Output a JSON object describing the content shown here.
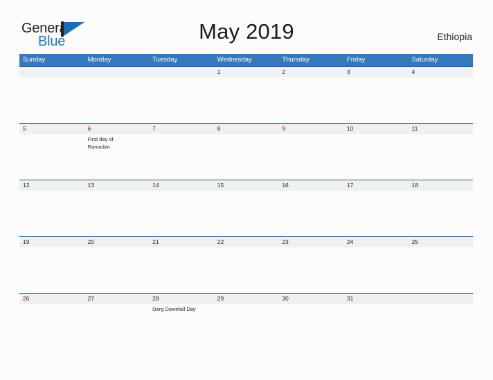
{
  "brand": {
    "name_part1": "General",
    "name_part2": "Blue",
    "mark": "flag-triangle-icon"
  },
  "header": {
    "title": "May 2019",
    "country": "Ethiopia"
  },
  "colors": {
    "header_blue": "#3579bd",
    "separator_blue": "#1f6099",
    "date_band_gray": "#f0f0f0",
    "logo_blue": "#1d76c4",
    "page_background": "#fcfcfd",
    "text_dark": "#231f20"
  },
  "calendar": {
    "month": "May",
    "year": "2019",
    "weekdays": [
      "Sunday",
      "Monday",
      "Tuesday",
      "Wednesday",
      "Thursday",
      "Friday",
      "Saturday"
    ],
    "weeks": [
      {
        "days": [
          {
            "num": "",
            "event": ""
          },
          {
            "num": "",
            "event": ""
          },
          {
            "num": "",
            "event": ""
          },
          {
            "num": "1",
            "event": ""
          },
          {
            "num": "2",
            "event": ""
          },
          {
            "num": "3",
            "event": ""
          },
          {
            "num": "4",
            "event": ""
          }
        ]
      },
      {
        "days": [
          {
            "num": "5",
            "event": ""
          },
          {
            "num": "6",
            "event": "First day of Ramadan"
          },
          {
            "num": "7",
            "event": ""
          },
          {
            "num": "8",
            "event": ""
          },
          {
            "num": "9",
            "event": ""
          },
          {
            "num": "10",
            "event": ""
          },
          {
            "num": "11",
            "event": ""
          }
        ]
      },
      {
        "days": [
          {
            "num": "12",
            "event": ""
          },
          {
            "num": "13",
            "event": ""
          },
          {
            "num": "14",
            "event": ""
          },
          {
            "num": "15",
            "event": ""
          },
          {
            "num": "16",
            "event": ""
          },
          {
            "num": "17",
            "event": ""
          },
          {
            "num": "18",
            "event": ""
          }
        ]
      },
      {
        "days": [
          {
            "num": "19",
            "event": ""
          },
          {
            "num": "20",
            "event": ""
          },
          {
            "num": "21",
            "event": ""
          },
          {
            "num": "22",
            "event": ""
          },
          {
            "num": "23",
            "event": ""
          },
          {
            "num": "24",
            "event": ""
          },
          {
            "num": "25",
            "event": ""
          }
        ]
      },
      {
        "days": [
          {
            "num": "26",
            "event": ""
          },
          {
            "num": "27",
            "event": ""
          },
          {
            "num": "28",
            "event": "Derg Downfall Day"
          },
          {
            "num": "29",
            "event": ""
          },
          {
            "num": "30",
            "event": ""
          },
          {
            "num": "31",
            "event": ""
          },
          {
            "num": "",
            "event": ""
          }
        ]
      }
    ]
  }
}
